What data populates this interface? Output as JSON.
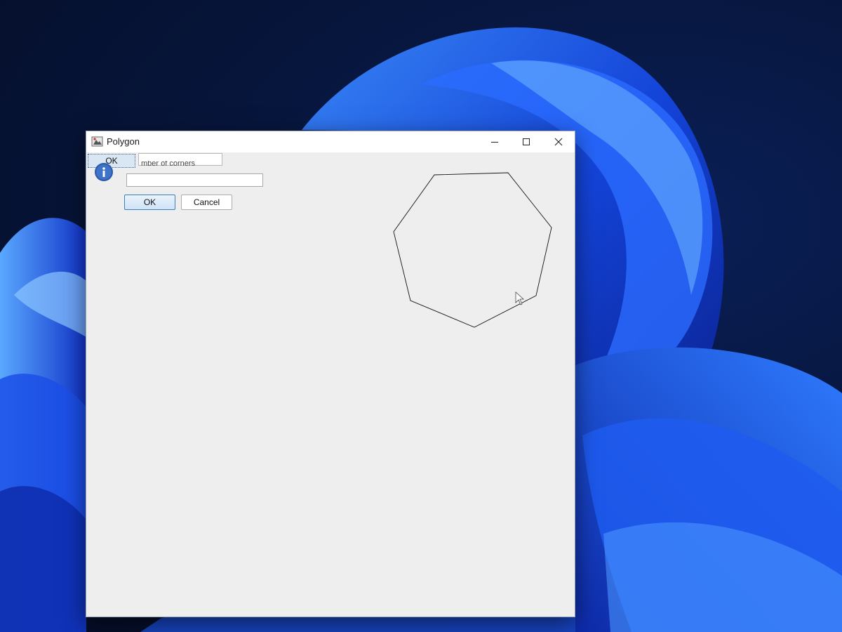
{
  "window": {
    "title": "Polygon",
    "controls": {
      "minimize_icon": "minimize-icon",
      "maximize_icon": "maximize-icon",
      "close_icon": "close-icon"
    }
  },
  "ghost": {
    "ok_label": "OK"
  },
  "dialog": {
    "prompt_label": "mber of corners",
    "input_value": "",
    "ok_label": "OK",
    "cancel_label": "Cancel",
    "icon": "info-icon"
  },
  "colors": {
    "window_bg": "#eeeeee",
    "titlebar_bg": "#ffffff",
    "polygon_stroke": "#111111",
    "ok_border": "#3c7fb1"
  }
}
